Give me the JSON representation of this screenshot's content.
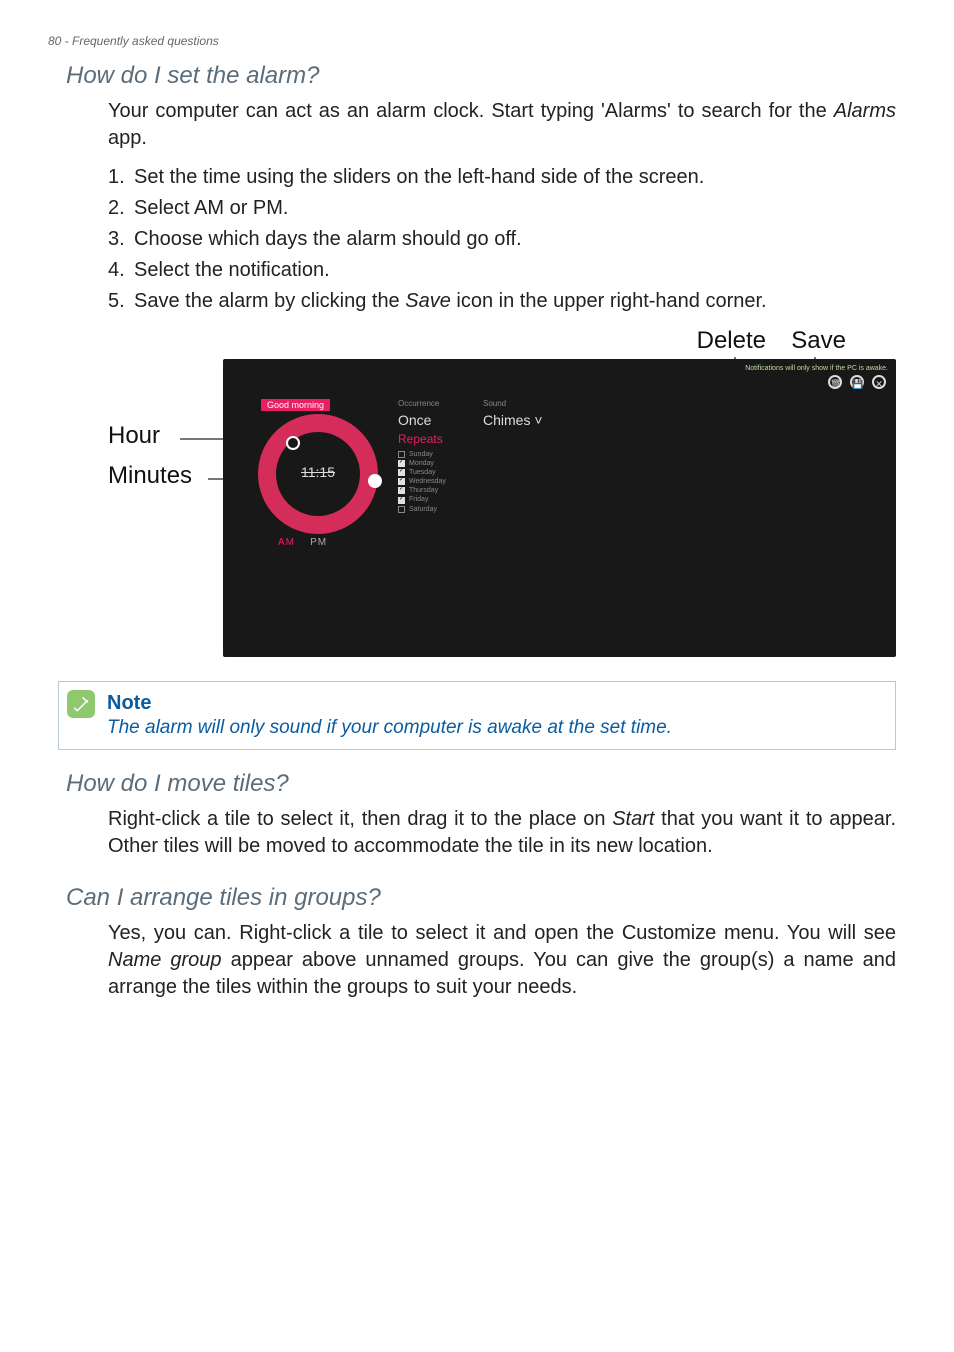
{
  "header": "80 - Frequently asked questions",
  "sections": {
    "alarm": {
      "heading": "How do I set the alarm?",
      "intro_part1": "Your computer can act as an alarm clock. Start typing 'Alarms' to search for the ",
      "intro_italic": "Alarms",
      "intro_part2": " app.",
      "steps_prefix": [
        "1.",
        "2.",
        "3.",
        "4.",
        "5."
      ],
      "steps": {
        "s1": "Set the time using the sliders on the left-hand side of the screen.",
        "s2": "Select AM or PM.",
        "s3": "Choose which days the alarm should go off.",
        "s4": "Select the notification.",
        "s5a": "Save the alarm by clicking the ",
        "s5i": "Save",
        "s5b": " icon in the upper right-hand corner."
      },
      "figure": {
        "labels": {
          "delete": "Delete",
          "save": "Save",
          "hour": "Hour",
          "minutes": "Minutes"
        },
        "title": "Good morning",
        "time": "11:15",
        "am": "AM",
        "pm": "PM",
        "occurrence_label": "Occurrence",
        "occurrence_value": "Once",
        "repeats_label": "Repeats",
        "sound_label": "Sound",
        "sound_value": "Chimes ˅",
        "topbar": "Notifications will only show if the PC is awake.",
        "days": [
          {
            "name": "Sunday",
            "checked": false
          },
          {
            "name": "Monday",
            "checked": true
          },
          {
            "name": "Tuesday",
            "checked": true
          },
          {
            "name": "Wednesday",
            "checked": true
          },
          {
            "name": "Thursday",
            "checked": true
          },
          {
            "name": "Friday",
            "checked": true
          },
          {
            "name": "Saturday",
            "checked": false
          }
        ]
      }
    },
    "moveTiles": {
      "heading": "How do I move tiles?",
      "body_a": "Right-click a tile to select it, then drag it to the place on ",
      "body_italic": "Start",
      "body_b": " that you want it to appear. Other tiles will be moved to accommodate the tile in its new location."
    },
    "groupTiles": {
      "heading": "Can I arrange tiles in groups?",
      "body_a": "Yes, you can. Right-click a tile to select it and open the Customize menu. You will see ",
      "body_italic": "Name group",
      "body_b": " appear above unnamed groups. You can give the group(s) a name and arrange the tiles within the groups to suit your needs."
    }
  },
  "note": {
    "title": "Note",
    "text": "The alarm will only sound if your computer is awake at the set time."
  }
}
